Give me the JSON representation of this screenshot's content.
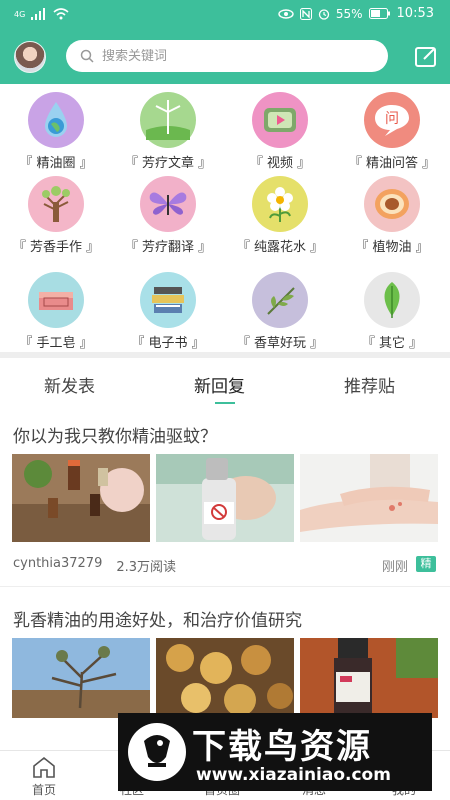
{
  "status_bar": {
    "signal_text": "4G",
    "battery": "55%",
    "time": "10:53"
  },
  "header": {
    "search_placeholder": "搜索关键词"
  },
  "categories": [
    {
      "label": "『 精油圈 』",
      "icon": "globe-drop-icon",
      "color": "#c9a3e6"
    },
    {
      "label": "『 芳疗文章 』",
      "icon": "windmill-icon",
      "color": "#a6d88f"
    },
    {
      "label": "『 视频 』",
      "icon": "video-icon",
      "color": "#ef93c4"
    },
    {
      "label": "『 精油问答 』",
      "icon": "chat-question-icon",
      "color": "#f08b7f"
    },
    {
      "label": "『 芳香手作 』",
      "icon": "tree-icon",
      "color": "#f4b6c8"
    },
    {
      "label": "『 芳疗翻译 』",
      "icon": "butterfly-icon",
      "color": "#f2b1c9"
    },
    {
      "label": "『 纯露花水 』",
      "icon": "flower-icon",
      "color": "#e5e06a"
    },
    {
      "label": "『 植物油 』",
      "icon": "peach-icon",
      "color": "#f3c3c3"
    },
    {
      "label": "『 手工皂 』",
      "icon": "soap-icon",
      "color": "#a8dde3"
    },
    {
      "label": "『 电子书 』",
      "icon": "books-icon",
      "color": "#a9e0e8"
    },
    {
      "label": "『 香草好玩 』",
      "icon": "herb-icon",
      "color": "#c6bfdc"
    },
    {
      "label": "『 其它 』",
      "icon": "leaf-icon",
      "color": "#e7e7e7"
    }
  ],
  "tabs": [
    {
      "label": "新发表"
    },
    {
      "label": "新回复"
    },
    {
      "label": "推荐贴"
    }
  ],
  "posts": [
    {
      "title": "你以为我只教你精油驱蚊？",
      "author": "cynthia37279",
      "reads": "2.3万阅读",
      "time": "刚刚",
      "badge": "精"
    },
    {
      "title": "乳香精油的用途好处，和治疗价值研究",
      "author": "",
      "reads": "",
      "time": "",
      "badge": ""
    }
  ],
  "bottom_nav": [
    {
      "label": "首页",
      "icon": "home-icon"
    },
    {
      "label": "社区",
      "icon": "community-icon"
    },
    {
      "label": "首页圈",
      "icon": "circle-icon"
    },
    {
      "label": "消息",
      "icon": "message-icon"
    },
    {
      "label": "我的",
      "icon": "profile-icon"
    }
  ],
  "watermark": {
    "title": "下载鸟资源",
    "url": "www.xiazainiao.com"
  }
}
